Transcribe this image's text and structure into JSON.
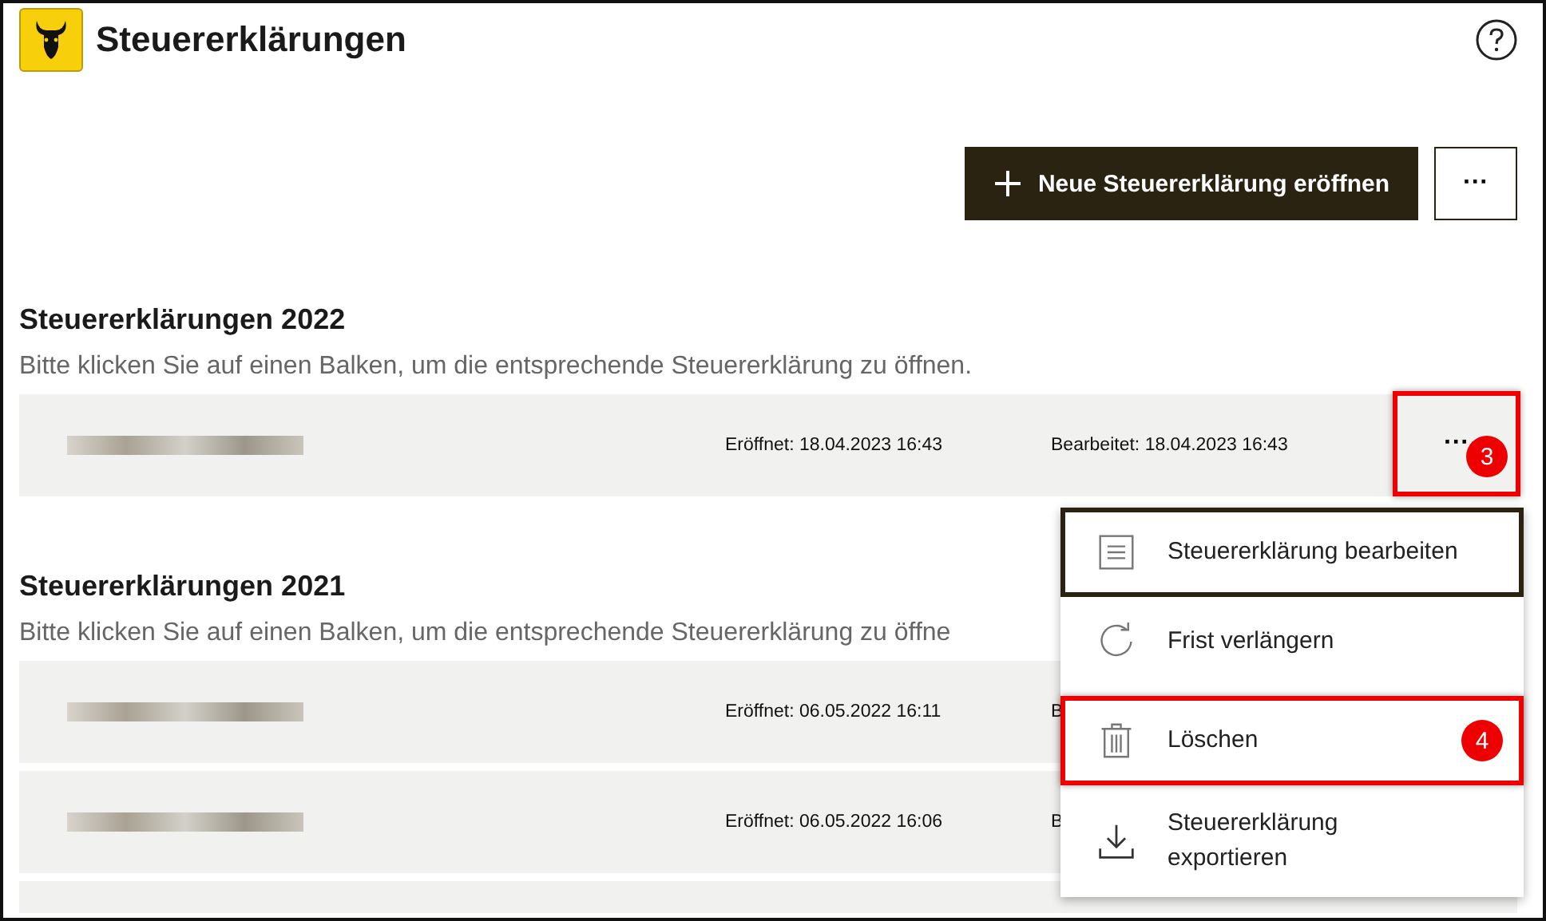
{
  "header": {
    "title": "Steuererklärungen"
  },
  "toolbar": {
    "new_button": "Neue Steuererklärung eröffnen",
    "more_button": "···"
  },
  "sections": [
    {
      "heading": "Steuererklärungen 2022",
      "subtitle": "Bitte klicken Sie auf einen Balken, um die entsprechende Steuererklärung zu öffnen.",
      "rows": [
        {
          "opened": "Eröffnet: 18.04.2023 16:43",
          "edited": "Bearbeitet: 18.04.2023 16:43",
          "more_button": "···",
          "callout": "3"
        }
      ]
    },
    {
      "heading": "Steuererklärungen 2021",
      "subtitle": "Bitte klicken Sie auf einen Balken, um die entsprechende Steuererklärung zu öffne",
      "rows": [
        {
          "opened": "Eröffnet: 06.05.2022 16:11",
          "edited": "B"
        },
        {
          "opened": "Eröffnet: 06.05.2022 16:06",
          "edited": "B"
        },
        {}
      ]
    }
  ],
  "menu": {
    "items": [
      {
        "kind": "document",
        "label": "Steuererklärung bearbeiten",
        "selected": true,
        "highlighted": false
      },
      {
        "kind": "refresh",
        "label": "Frist verlängern",
        "selected": false,
        "highlighted": false
      },
      {
        "kind": "trash",
        "label": "Löschen",
        "selected": false,
        "highlighted": true,
        "callout": "4"
      },
      {
        "kind": "download",
        "label": "Steuererklärung exportieren",
        "selected": false,
        "highlighted": false
      }
    ]
  }
}
